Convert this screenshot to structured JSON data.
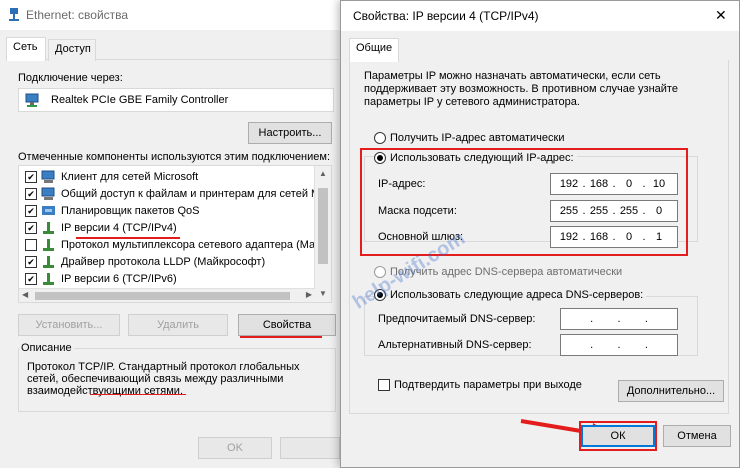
{
  "left_window": {
    "title": "Ethernet: свойства",
    "tabs": [
      "Сеть",
      "Доступ"
    ],
    "connect_using_label": "Подключение через:",
    "adapter_name": "Realtek PCIe GBE Family Controller",
    "configure_button": "Настроить...",
    "components_label": "Отмеченные компоненты используются этим подключением:",
    "components": [
      {
        "label": "Клиент для сетей Microsoft",
        "checked": true,
        "icon": "network-client-icon"
      },
      {
        "label": "Общий доступ к файлам и принтерам для сетей Mi",
        "checked": true,
        "icon": "file-share-icon"
      },
      {
        "label": "Планировщик пакетов QoS",
        "checked": true,
        "icon": "qos-icon"
      },
      {
        "label": "IP версии 4 (TCP/IPv4)",
        "checked": true,
        "icon": "protocol-icon"
      },
      {
        "label": "Протокол мультиплексора сетевого адаптера (Майк",
        "checked": false,
        "icon": "protocol-icon"
      },
      {
        "label": "Драйвер протокола LLDP (Майкрософт)",
        "checked": true,
        "icon": "protocol-icon"
      },
      {
        "label": "IP версии 6 (TCP/IPv6)",
        "checked": true,
        "icon": "protocol-icon"
      }
    ],
    "install_button": "Установить...",
    "remove_button": "Удалить",
    "properties_button": "Свойства",
    "description_title": "Описание",
    "description_text": "Протокол TCP/IP. Стандартный протокол глобальных сетей, обеспечивающий связь между различными взаимодействующими сетями.",
    "ok_button": "OK"
  },
  "right_window": {
    "title": "Свойства: IP версии 4 (TCP/IPv4)",
    "tab": "Общие",
    "intro_text": "Параметры IP можно назначать автоматически, если сеть поддерживает эту возможность. В противном случае узнайте параметры IP у сетевого администратора.",
    "auto_ip_label": "Получить IP-адрес автоматически",
    "manual_ip_label": "Использовать следующий IP-адрес:",
    "ip_address_label": "IP-адрес:",
    "ip_address": [
      "192",
      "168",
      "0",
      "10"
    ],
    "subnet_label": "Маска подсети:",
    "subnet": [
      "255",
      "255",
      "255",
      "0"
    ],
    "gateway_label": "Основной шлюз:",
    "gateway": [
      "192",
      "168",
      "0",
      "1"
    ],
    "auto_dns_label": "Получить адрес DNS-сервера автоматически",
    "manual_dns_label": "Использовать следующие адреса DNS-серверов:",
    "preferred_dns_label": "Предпочитаемый DNS-сервер:",
    "alternate_dns_label": "Альтернативный DNS-сервер:",
    "validate_label": "Подтвердить параметры при выходе",
    "advanced_button": "Дополнительно...",
    "ok_button": "ОК",
    "cancel_button": "Отмена",
    "watermark": "help-wifi.com"
  },
  "colors": {
    "highlight_red": "#e31d1d",
    "accent_blue": "#0078d7"
  }
}
